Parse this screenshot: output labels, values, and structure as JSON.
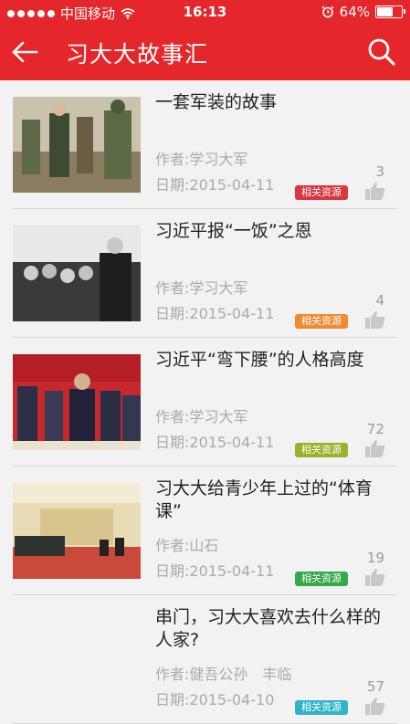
{
  "status_bar": {
    "carrier": "中国移动",
    "time": "16:13",
    "battery": "64%",
    "battery_level": 0.64
  },
  "nav": {
    "title": "习大大故事汇",
    "back_icon": "back-arrow-icon",
    "search_icon": "search-icon"
  },
  "articles": [
    {
      "title": "一套军装的故事",
      "author": "作者:学习大军",
      "date": "日期:2015-04-11",
      "tag": "相关资源",
      "tag_color": "#d9363e",
      "likes": "3"
    },
    {
      "title": "习近平报“一饭”之恩",
      "author": "作者:学习大军",
      "date": "日期:2015-04-11",
      "tag": "相关资源",
      "tag_color": "#f08a30",
      "likes": "4"
    },
    {
      "title": "习近平“弯下腰”的人格高度",
      "author": "作者:学习大军",
      "date": "日期:2015-04-11",
      "tag": "相关资源",
      "tag_color": "#9ab22a",
      "likes": "72"
    },
    {
      "title": "习大大给青少年上过的“体育课”",
      "author": "作者:山石",
      "date": "日期:2015-04-11",
      "tag": "相关资源",
      "tag_color": "#35a84a",
      "likes": "19"
    },
    {
      "title": "串门，习大大喜欢去什么样的人家?",
      "author": "作者:健吾公孙　丰临",
      "date": "日期:2015-04-10",
      "tag": "相关资源",
      "tag_color": "#2eb3c9",
      "likes": "57"
    }
  ],
  "colors": {
    "brand": "#e5262a"
  }
}
